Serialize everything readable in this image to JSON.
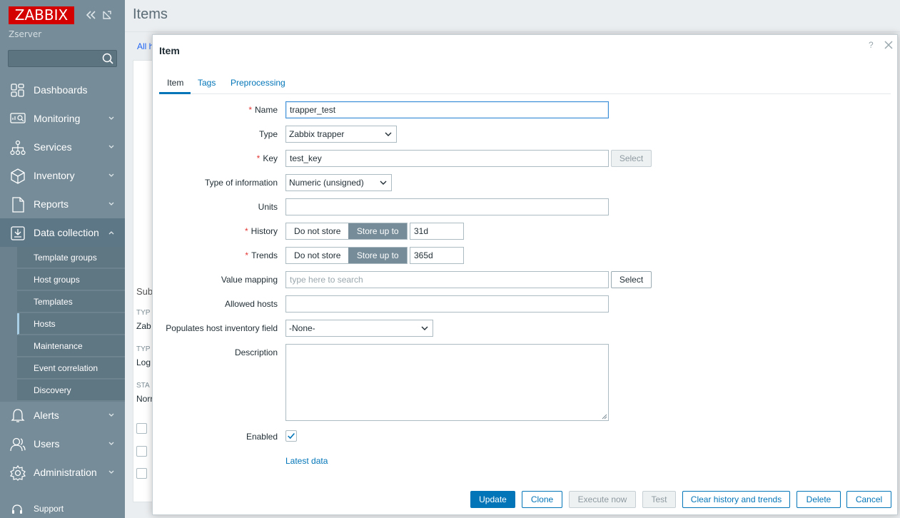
{
  "sidebar": {
    "logo": "ZABBIX",
    "server": "Zserver",
    "search": {
      "value": "",
      "placeholder": ""
    },
    "menu": [
      {
        "label": "Dashboards",
        "icon": "dashboards-icon"
      },
      {
        "label": "Monitoring",
        "icon": "monitoring-icon"
      },
      {
        "label": "Services",
        "icon": "services-icon"
      },
      {
        "label": "Inventory",
        "icon": "inventory-icon"
      },
      {
        "label": "Reports",
        "icon": "reports-icon"
      },
      {
        "label": "Data collection",
        "icon": "data-collection-icon"
      },
      {
        "label": "Alerts",
        "icon": "alerts-icon"
      },
      {
        "label": "Users",
        "icon": "users-icon"
      },
      {
        "label": "Administration",
        "icon": "administration-icon"
      }
    ],
    "submenu": [
      {
        "label": "Template groups"
      },
      {
        "label": "Host groups"
      },
      {
        "label": "Templates"
      },
      {
        "label": "Hosts"
      },
      {
        "label": "Maintenance"
      },
      {
        "label": "Event correlation"
      },
      {
        "label": "Discovery"
      }
    ],
    "selected_submenu": "Hosts",
    "support": "Support"
  },
  "page": {
    "title": "Items",
    "bg_fragments": {
      "all": "All h",
      "sub": "Sub",
      "typ1": "TYP",
      "zab": "Zab",
      "typ2": "TYP",
      "log": "Log",
      "sta": "STA",
      "nor": "Norr"
    }
  },
  "modal": {
    "title": "Item",
    "help": "?",
    "tabs": [
      "Item",
      "Tags",
      "Preprocessing"
    ],
    "active_tab": "Item",
    "fields": {
      "name": {
        "label": "Name",
        "required": true,
        "value": "trapper_test"
      },
      "type": {
        "label": "Type",
        "value": "Zabbix trapper"
      },
      "key": {
        "label": "Key",
        "required": true,
        "value": "test_key",
        "button": "Select"
      },
      "type_of_information": {
        "label": "Type of information",
        "value": "Numeric (unsigned)"
      },
      "units": {
        "label": "Units",
        "value": ""
      },
      "history": {
        "label": "History",
        "required": true,
        "options": [
          "Do not store",
          "Store up to"
        ],
        "selected": "Store up to",
        "value": "31d"
      },
      "trends": {
        "label": "Trends",
        "required": true,
        "options": [
          "Do not store",
          "Store up to"
        ],
        "selected": "Store up to",
        "value": "365d"
      },
      "value_mapping": {
        "label": "Value mapping",
        "placeholder": "type here to search",
        "button": "Select"
      },
      "allowed_hosts": {
        "label": "Allowed hosts",
        "value": ""
      },
      "populates_inventory": {
        "label": "Populates host inventory field",
        "value": "-None-"
      },
      "description": {
        "label": "Description",
        "value": ""
      },
      "enabled": {
        "label": "Enabled",
        "checked": true
      }
    },
    "latest_data_link": "Latest data",
    "buttons": {
      "update": "Update",
      "clone": "Clone",
      "execute_now": "Execute now",
      "test": "Test",
      "clear_history": "Clear history and trends",
      "delete": "Delete",
      "cancel": "Cancel"
    }
  },
  "colors": {
    "sidebar": "#768d99",
    "accent": "#0275b8",
    "required": "#e33734",
    "logo_bg": "#d40000"
  }
}
